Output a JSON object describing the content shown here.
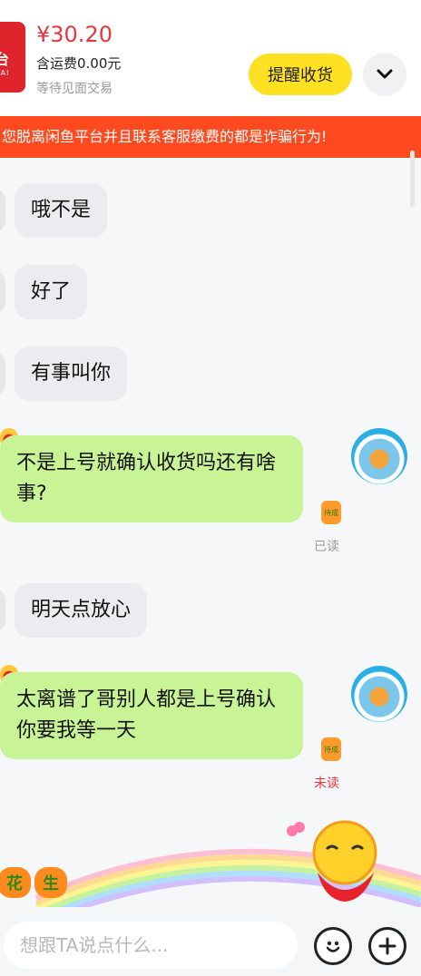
{
  "header": {
    "product_thumb_text": "台",
    "product_thumb_subtext": "ITAI",
    "price": "¥30.20",
    "shipping": "含运费0.00元",
    "status": "等待见面交易",
    "remind_button": "提醒收货",
    "expand_icon": "chevron-down-icon"
  },
  "warning": {
    "text": "您脱离闲鱼平台并且联系客服缴费的都是诈骗行为!"
  },
  "messages": [
    {
      "side": "left",
      "text": "哦不是"
    },
    {
      "side": "left",
      "text": "好了"
    },
    {
      "side": "left",
      "text": "有事叫你"
    },
    {
      "side": "right",
      "text": "不是上号就确认收货吗还有啥事?",
      "read_status": "已读",
      "badge": "待成"
    },
    {
      "side": "left",
      "text": "明天点放心"
    },
    {
      "side": "right",
      "text": "太离谱了哥别人都是上号确认你要我等一天",
      "read_status": "未读",
      "badge": "待成"
    }
  ],
  "decoration": {
    "fruit_1": "花",
    "fruit_2": "生"
  },
  "input": {
    "placeholder": "想跟TA说点什么..."
  },
  "colors": {
    "accent_yellow": "#ffe124",
    "warning_bg": "#ff4a1f",
    "price_red": "#e5373a",
    "outgoing_bubble": "#c9f495",
    "incoming_bubble": "#ebecef",
    "unread_red": "#e5373a",
    "read_gray": "#999999"
  }
}
